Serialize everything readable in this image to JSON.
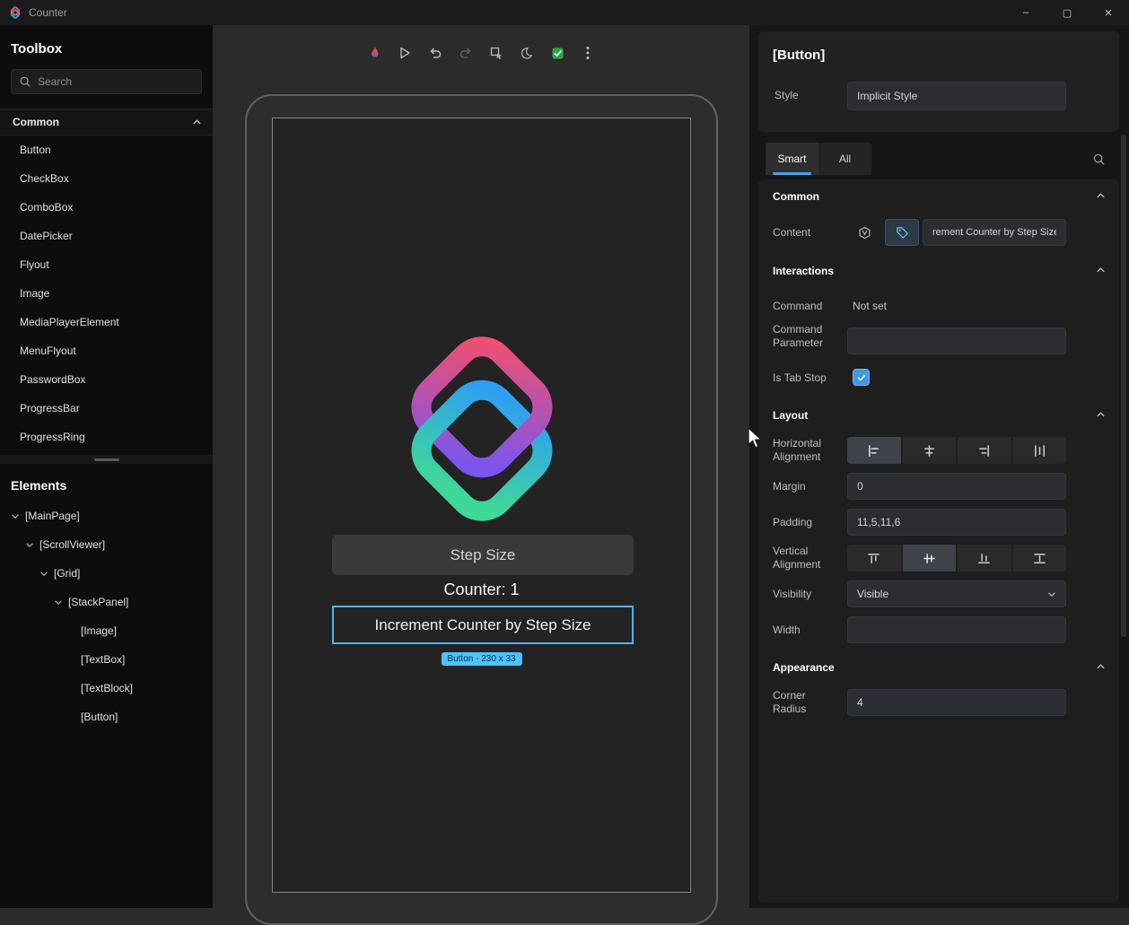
{
  "titlebar": {
    "title": "Counter",
    "minimize_glyph": "–",
    "maximize_glyph": "▢",
    "close_glyph": "✕"
  },
  "toolbox": {
    "title": "Toolbox",
    "search_placeholder": "Search",
    "section_label": "Common",
    "items": [
      "Button",
      "CheckBox",
      "ComboBox",
      "DatePicker",
      "Flyout",
      "Image",
      "MediaPlayerElement",
      "MenuFlyout",
      "PasswordBox",
      "ProgressBar",
      "ProgressRing"
    ]
  },
  "elements": {
    "title": "Elements",
    "tree": [
      {
        "label": "[MainPage]"
      },
      {
        "label": "[ScrollViewer]"
      },
      {
        "label": "[Grid]"
      },
      {
        "label": "[StackPanel]"
      },
      {
        "label": "[Image]"
      },
      {
        "label": "[TextBox]"
      },
      {
        "label": "[TextBlock]"
      },
      {
        "label": "[Button]"
      }
    ]
  },
  "canvas": {
    "device": {
      "textbox_text": "Step Size",
      "counter_text": "Counter: 1",
      "button_label": "Increment Counter by Step Size",
      "selection_badge": "Button - 230 x 33"
    }
  },
  "properties": {
    "header": "[Button]",
    "style": {
      "label": "Style",
      "value": "Implicit Style"
    },
    "tabs": {
      "smart": "Smart",
      "all": "All"
    },
    "sections": {
      "common": {
        "title": "Common",
        "content_label": "Content",
        "content_value": "rement Counter by Step Size"
      },
      "interactions": {
        "title": "Interactions",
        "command_label": "Command",
        "command_value": "Not set",
        "command_parameter_label": "Command Parameter",
        "command_parameter_value": "",
        "is_tab_stop_label": "Is Tab Stop"
      },
      "layout": {
        "title": "Layout",
        "horizontal_alignment_label": "Horizontal Alignment",
        "margin_label": "Margin",
        "margin_value": "0",
        "padding_label": "Padding",
        "padding_value": "11,5,11,6",
        "vertical_alignment_label": "Vertical Alignment",
        "visibility_label": "Visibility",
        "visibility_value": "Visible",
        "width_label": "Width",
        "width_value": ""
      },
      "appearance": {
        "title": "Appearance",
        "corner_radius_label": "Corner Radius",
        "corner_radius_value": "4"
      }
    }
  },
  "colors": {
    "accent": "#4ba0e8",
    "selection_blue": "#4fb3f0",
    "badge_blue": "#4cc2ff",
    "check_green": "#3fbf5f"
  }
}
